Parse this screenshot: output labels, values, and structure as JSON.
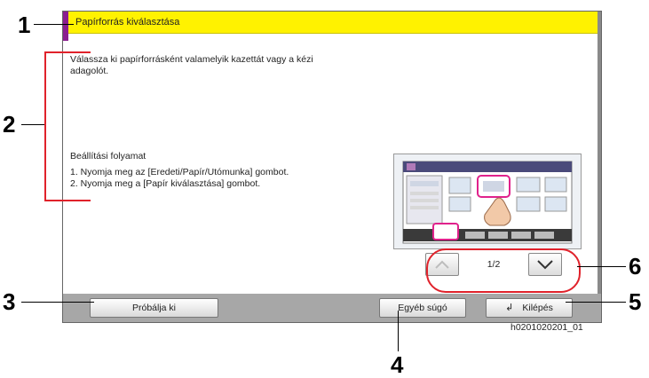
{
  "window": {
    "title": "Papírforrás kiválasztása"
  },
  "content": {
    "description": "Válassza ki papírforrásként valamelyik kazettát vagy a kézi adagolót.",
    "procedure_title": "Beállítási folyamat",
    "steps": [
      "1. Nyomja meg az [Eredeti/Papír/Utómunka] gombot.",
      "2. Nyomja meg a [Papír kiválasztása] gombot."
    ]
  },
  "pager": {
    "page": "1/2",
    "up_icon": "chevron-up-icon",
    "down_icon": "chevron-down-icon"
  },
  "bottom": {
    "try_label": "Próbálja ki",
    "help_label": "Egyéb súgó",
    "exit_label": "Kilépés",
    "exit_icon": "enter-icon"
  },
  "callouts": [
    "1",
    "2",
    "3",
    "4",
    "5",
    "6"
  ],
  "caption": "h0201020201_01",
  "colors": {
    "title_bar": "#fff200",
    "accent_strip": "#8b1e8f",
    "highlight": "#e0222b",
    "bar_gray": "#a7a7a7"
  }
}
